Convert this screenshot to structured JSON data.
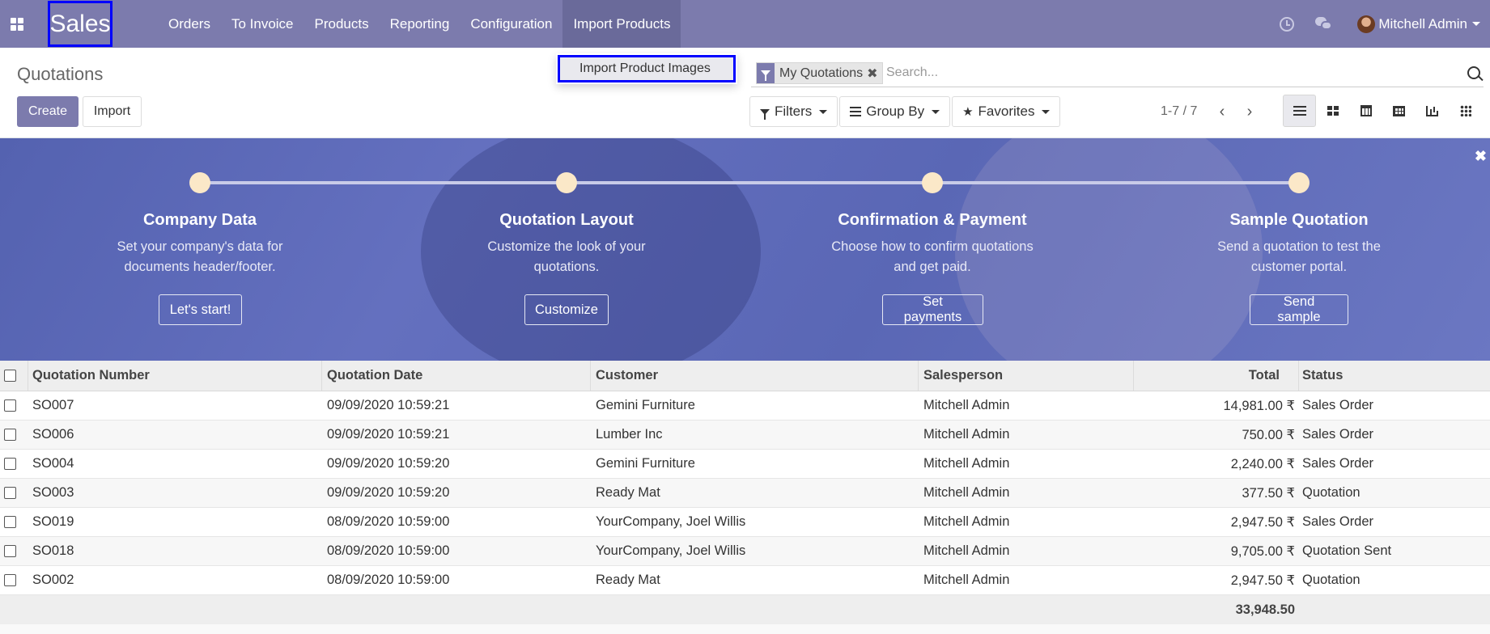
{
  "navbar": {
    "brand": "Sales",
    "menu": [
      "Orders",
      "To Invoice",
      "Products",
      "Reporting",
      "Configuration",
      "Import Products"
    ],
    "user_name": "Mitchell Admin"
  },
  "dropdown": {
    "item": "Import Product Images"
  },
  "control_panel": {
    "title": "Quotations",
    "create_label": "Create",
    "import_label": "Import",
    "facet_label": "My Quotations",
    "search_placeholder": "Search...",
    "filters_label": "Filters",
    "groupby_label": "Group By",
    "favorites_label": "Favorites",
    "pager": "1-7 / 7"
  },
  "banner": {
    "steps": [
      {
        "title": "Company Data",
        "desc1": "Set your company's data for",
        "desc2": "documents header/footer.",
        "button": "Let's start!"
      },
      {
        "title": "Quotation Layout",
        "desc1": "Customize the look of your",
        "desc2": "quotations.",
        "button": "Customize"
      },
      {
        "title": "Confirmation & Payment",
        "desc1": "Choose how to confirm quotations",
        "desc2": "and get paid.",
        "button": "Set payments"
      },
      {
        "title": "Sample Quotation",
        "desc1": "Send a quotation to test the",
        "desc2": "customer portal.",
        "button": "Send sample"
      }
    ]
  },
  "table": {
    "headers": [
      "Quotation Number",
      "Quotation Date",
      "Customer",
      "Salesperson",
      "Total",
      "Status"
    ],
    "rows": [
      [
        "SO007",
        "09/09/2020 10:59:21",
        "Gemini Furniture",
        "Mitchell Admin",
        "14,981.00 ₹",
        "Sales Order"
      ],
      [
        "SO006",
        "09/09/2020 10:59:21",
        "Lumber Inc",
        "Mitchell Admin",
        "750.00 ₹",
        "Sales Order"
      ],
      [
        "SO004",
        "09/09/2020 10:59:20",
        "Gemini Furniture",
        "Mitchell Admin",
        "2,240.00 ₹",
        "Sales Order"
      ],
      [
        "SO003",
        "09/09/2020 10:59:20",
        "Ready Mat",
        "Mitchell Admin",
        "377.50 ₹",
        "Quotation"
      ],
      [
        "SO019",
        "08/09/2020 10:59:00",
        "YourCompany, Joel Willis",
        "Mitchell Admin",
        "2,947.50 ₹",
        "Sales Order"
      ],
      [
        "SO018",
        "08/09/2020 10:59:00",
        "YourCompany, Joel Willis",
        "Mitchell Admin",
        "9,705.00 ₹",
        "Quotation Sent"
      ],
      [
        "SO002",
        "08/09/2020 10:59:00",
        "Ready Mat",
        "Mitchell Admin",
        "2,947.50 ₹",
        "Quotation"
      ]
    ],
    "footer_total": "33,948.50"
  },
  "colors": {
    "brand": "#7c7bad",
    "banner": "#5f6cb8",
    "highlight": "#0000ff"
  }
}
